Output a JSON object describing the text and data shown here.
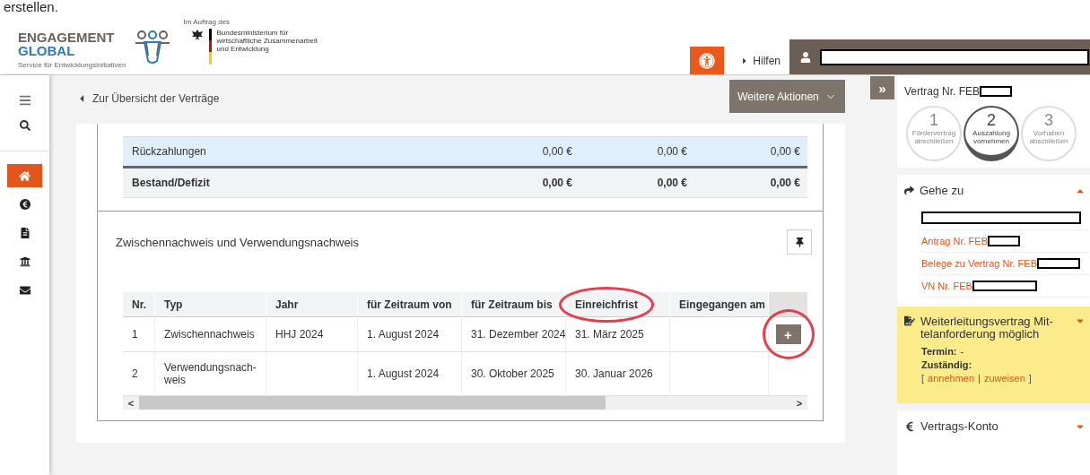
{
  "top_caption": "erstellen.",
  "header": {
    "logo": {
      "line1": "ENGAGEMENT",
      "line2": "GLOBAL",
      "tagline": "Service für Entwicklungsinitiativen"
    },
    "ministry": {
      "caption": "Im Auftrag des",
      "lines": [
        "Bundesministerium für",
        "wirtschaftliche Zusammenarbeit",
        "und Entwicklung"
      ]
    },
    "help": "Hilfen"
  },
  "sidebar": {
    "nav": [
      {
        "selected": true
      },
      {
        "selected": false
      },
      {
        "selected": false
      },
      {
        "selected": false
      },
      {
        "selected": false
      }
    ]
  },
  "back_link": "Zur Übersicht der Verträge",
  "actions_button": "Weitere Aktionen",
  "summary": {
    "rows": [
      {
        "kind": "plain",
        "label": "Rückzahlungen",
        "values": [
          "0,00 €",
          "0,00 €",
          "0,00 €"
        ],
        "highlighted": true
      },
      {
        "kind": "total",
        "label": "Bestand/Defizit",
        "values": [
          "0,00 €",
          "0,00 €",
          "0,00 €"
        ],
        "highlighted": false
      }
    ]
  },
  "section": {
    "title": "Zwischennachweis und Verwendungsnachweis",
    "columns": [
      {
        "label": "Nr.",
        "circled": false
      },
      {
        "label": "Typ",
        "circled": false
      },
      {
        "label": "Jahr",
        "circled": false
      },
      {
        "label": "für Zeitraum von",
        "circled": false
      },
      {
        "label": "für Zeitraum bis",
        "circled": false
      },
      {
        "label": "Einreichfrist",
        "circled": true
      },
      {
        "label": "Eingegangen am",
        "circled": false
      }
    ],
    "rows": [
      {
        "cells": [
          "1",
          "Zwischennachweis",
          "HHJ 2024",
          "1. August 2024",
          "31. Dezember 2024",
          "31. März 2025",
          ""
        ],
        "action": {
          "label": "+",
          "circled": true
        }
      },
      {
        "cells": [
          "2",
          "Verwendungsnach-weis",
          "",
          "1. August 2024",
          "30. Oktober 2025",
          "30. Januar 2026",
          ""
        ]
      }
    ],
    "scroll_left": "<",
    "scroll_right": ">"
  },
  "panel": {
    "toggle": "»",
    "contract": "Vertrag Nr. FEB",
    "steps": [
      {
        "number": "1",
        "label": "Fördervertrag abschließen",
        "selected": false
      },
      {
        "number": "2",
        "label": "Auszahlung vornehmen",
        "selected": true
      },
      {
        "number": "3",
        "label": "Vorhaben abschließen",
        "selected": false
      }
    ],
    "goto": {
      "title": "Gehe zu",
      "expanded": true,
      "links": [
        {
          "kind": "redacted"
        },
        {
          "kind": "link",
          "text": "Antrag Nr. FEB"
        },
        {
          "kind": "link",
          "text": "Belege zu Vertrag Nr. FEB"
        },
        {
          "kind": "link",
          "text": "VN Nr. FEB"
        }
      ]
    },
    "task": {
      "title": "Weiterleitungsvertrag Mit-telanforderung möglich",
      "expanded": true,
      "termin_label": "Termin:",
      "termin_value": "-",
      "owner_label": "Zuständig:",
      "open": "[",
      "accept": "annehmen",
      "sep": "|",
      "assign": "zuweisen",
      "close": "]"
    },
    "account": {
      "title": "Vertrags-Konto",
      "expanded": false
    }
  }
}
